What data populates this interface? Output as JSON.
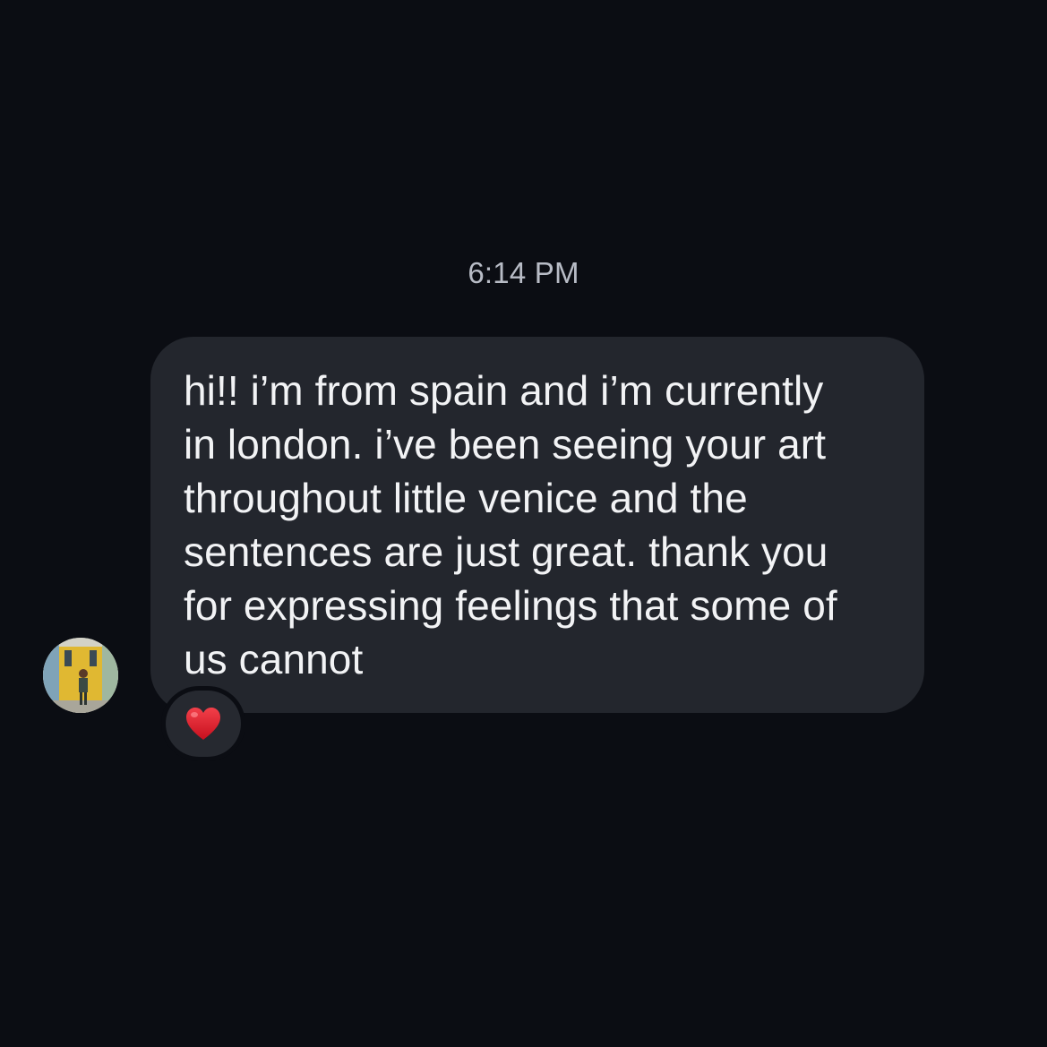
{
  "thread": {
    "timestamp": "6:14 PM",
    "message": {
      "text": "hi!! i’m from spain and i’m currently\nin london. i’ve been seeing your art\nthroughout little venice and the\nsentences are just great. thank you\nfor expressing feelings that some of\nus cannot",
      "reaction_icon": "red-heart-icon",
      "reaction_color": "#e0202e"
    },
    "sender": {
      "avatar_icon": "avatar-photo"
    }
  },
  "colors": {
    "background": "#0b0d13",
    "bubble": "#23262d",
    "text": "#f2f3f5",
    "timestamp": "#b8bcc6"
  }
}
